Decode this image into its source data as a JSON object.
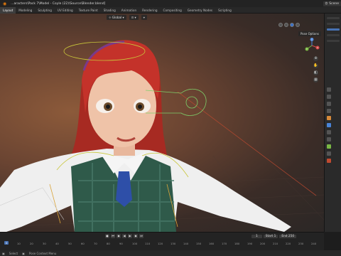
{
  "window": {
    "title": "...aracters\\Pack 7\\Model - Coyle (22)\\Source\\Blender.blend]",
    "scene_label": "Scene"
  },
  "workspace_tabs": [
    {
      "label": "Layout",
      "active": true
    },
    {
      "label": "Modeling",
      "active": false
    },
    {
      "label": "Sculpting",
      "active": false
    },
    {
      "label": "UV Editing",
      "active": false
    },
    {
      "label": "Texture Paint",
      "active": false
    },
    {
      "label": "Shading",
      "active": false
    },
    {
      "label": "Animation",
      "active": false
    },
    {
      "label": "Rendering",
      "active": false
    },
    {
      "label": "Compositing",
      "active": false
    },
    {
      "label": "Geometry Nodes",
      "active": false
    },
    {
      "label": "Scripting",
      "active": false
    }
  ],
  "viewport": {
    "transform_orientation": "Global",
    "pose_options": "Pose Options",
    "axis_labels": {
      "x": "X",
      "y": "Y",
      "z": "Z"
    }
  },
  "timeline": {
    "current_frame": "1",
    "start_label": "Start",
    "start_value": "1",
    "end_label": "End",
    "end_value": "250",
    "ruler": [
      "0",
      "10",
      "20",
      "30",
      "40",
      "50",
      "60",
      "70",
      "80",
      "90",
      "100",
      "110",
      "120",
      "130",
      "140",
      "150",
      "160",
      "170",
      "180",
      "190",
      "200",
      "210",
      "220",
      "230",
      "240"
    ]
  },
  "status": {
    "select_hint": "Select",
    "context_hint": "Pose Context Menu"
  },
  "colors": {
    "accent_blue": "#4772b3",
    "hair_red": "#c4322a",
    "plaid_green": "#2f5a4a",
    "rig_yellow": "#c9c63a",
    "rig_green": "#7ed06a"
  }
}
